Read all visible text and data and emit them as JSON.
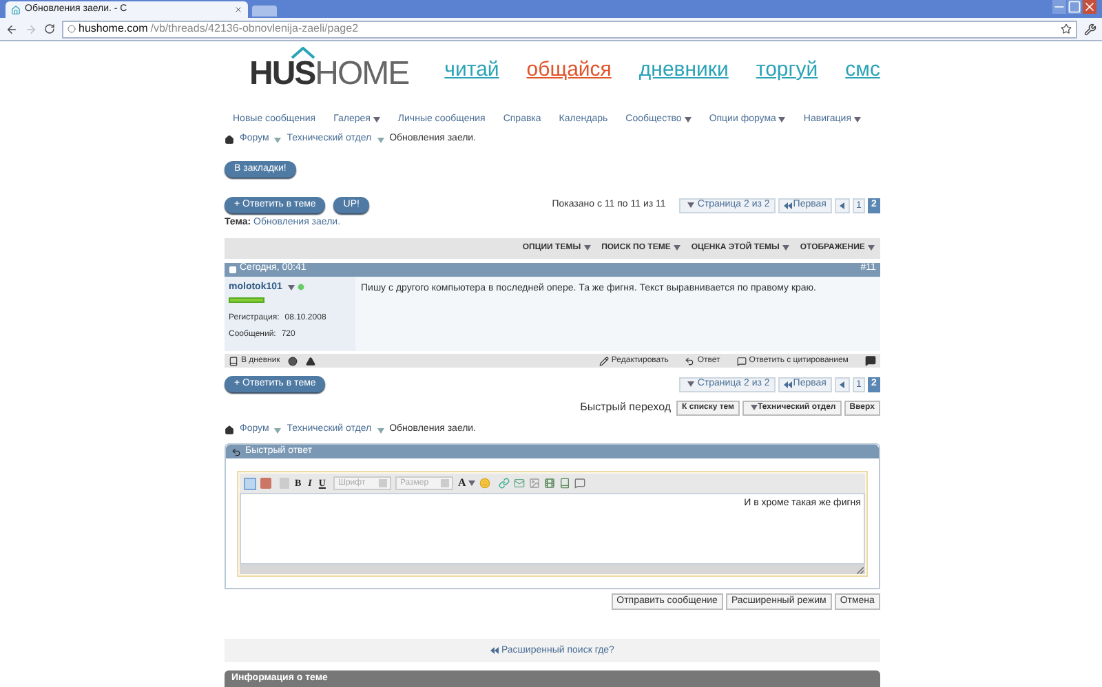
{
  "browser": {
    "tab_title": "Обновления заели. - С",
    "url_host": "hushome.com",
    "url_path": "/vb/threads/42136-obnovlenija-zaeli/page2"
  },
  "logo": {
    "part_1": "HUS",
    "part_2": "HOME"
  },
  "top_links": [
    {
      "label": "читай",
      "color": "#2aa3b8"
    },
    {
      "label": "общайся",
      "color": "#e0542a"
    },
    {
      "label": "дневники",
      "color": "#2aa3b8"
    },
    {
      "label": "торгуй",
      "color": "#2aa3b8"
    },
    {
      "label": "смс",
      "color": "#2aa3b8"
    }
  ],
  "nav_items": [
    {
      "label": "Новые сообщения",
      "has_menu": false
    },
    {
      "label": "Галерея",
      "has_menu": true
    },
    {
      "label": "Личные сообщения",
      "has_menu": false
    },
    {
      "label": "Справка",
      "has_menu": false
    },
    {
      "label": "Календарь",
      "has_menu": false
    },
    {
      "label": "Сообщество",
      "has_menu": true
    },
    {
      "label": "Опции форума",
      "has_menu": true
    },
    {
      "label": "Навигация",
      "has_menu": true
    }
  ],
  "breadcrumb": [
    "Форум",
    "Технический отдел",
    "Обновления заели."
  ],
  "bookmark_button": "В закладки!",
  "reply_button": "+ Ответить в теме",
  "up_button": "UP!",
  "shown": "Показано с 11 по 11 из 11",
  "pagination_top": {
    "page_label": "Страница 2 из 2",
    "first": "Первая",
    "pages": [
      {
        "label": "1",
        "selected": false
      },
      {
        "label": "2",
        "selected": true
      }
    ]
  },
  "topic": {
    "label": "Тема:",
    "title": "Обновления заели."
  },
  "thread_tools": [
    "ОПЦИИ ТЕМЫ",
    "ПОИСК ПО ТЕМЕ",
    "ОЦЕНКА ЭТОЙ ТЕМЫ",
    "ОТОБРАЖЕНИЕ"
  ],
  "post": {
    "date": "Сегодня, 00:41",
    "number": "#11",
    "username": "molotok101",
    "online": true,
    "reg_label": "Регистрация:",
    "reg_date": "08.10.2008",
    "posts_label": "Сообщений:",
    "posts": "720",
    "text": "Пишу с другого компьютера в последней опере. Та же фигня. Текст выравнивается по правому краю.",
    "diary": "В дневник",
    "actions": [
      "Редактировать",
      "Ответ",
      "Ответить с цитированием"
    ]
  },
  "reply_button_bottom": "+ Ответить в теме",
  "pagination_bottom": {
    "page_label": "Страница 2 из 2",
    "first": "Первая",
    "pages": [
      {
        "label": "1",
        "selected": false
      },
      {
        "label": "2",
        "selected": true
      }
    ]
  },
  "quick_nav": {
    "label": "Быстрый переход",
    "buttons": [
      {
        "label": "К списку тем",
        "has_menu": false
      },
      {
        "label": "Технический отдел",
        "has_menu": true
      },
      {
        "label": "Вверх",
        "has_menu": false
      }
    ]
  },
  "breadcrumb_bottom": [
    "Форум",
    "Технический отдел",
    "Обновления заели."
  ],
  "quick_reply": {
    "title": "Быстрый ответ",
    "font_placeholder": "Шрифт",
    "size_placeholder": "Размер",
    "format_buttons": [
      "B",
      "I",
      "U"
    ],
    "color_button": "A",
    "value": "И в хроме такая же фигня",
    "buttons": [
      "Отправить сообщение",
      "Расширенный режим",
      "Отмена"
    ]
  },
  "search_link": "Расширенный поиск где?",
  "info_title": "Информация о теме"
}
